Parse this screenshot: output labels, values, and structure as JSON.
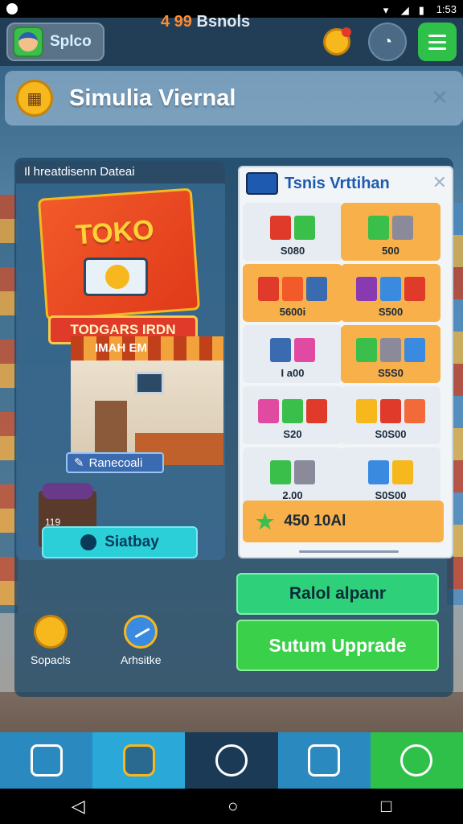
{
  "status_bar": {
    "time": "1:53"
  },
  "header": {
    "player_name": "Splco",
    "bonus_amount": "4 99",
    "bonus_label": "Bsnols"
  },
  "title": {
    "text": "Simulia Viernal"
  },
  "store_card": {
    "header": "Il hreatdisenn Dateai",
    "logo": "TOKO",
    "banner": "TODGARS IRDN",
    "sign": "IMAH EM",
    "discount_tag": "Ranecoali",
    "cart_count": "119",
    "start_button": "Siatbay",
    "mini_items": [
      {
        "label": "Sopacls",
        "icon": "coin-stack-icon"
      },
      {
        "label": "Arhsitke",
        "icon": "analytics-icon"
      }
    ]
  },
  "items_panel": {
    "title": "Tsnis Vrttihan",
    "items": [
      {
        "price": "S080",
        "style": "white",
        "colors": [
          "#e03a2a",
          "#3abf4a"
        ]
      },
      {
        "price": "500",
        "style": "orange",
        "colors": [
          "#3abf4a",
          "#8a8a9a"
        ]
      },
      {
        "price": "5600i",
        "style": "orange",
        "colors": [
          "#e03a2a",
          "#f25a2a",
          "#3a6ab0"
        ]
      },
      {
        "price": "S500",
        "style": "orange",
        "colors": [
          "#8a3ab0",
          "#3a8ae0",
          "#e03a2a"
        ]
      },
      {
        "price": "I a00",
        "style": "white",
        "colors": [
          "#3a6ab0",
          "#e04aa0"
        ]
      },
      {
        "price": "S5S0",
        "style": "orange",
        "colors": [
          "#3abf4a",
          "#8a8a9a",
          "#3a8ae0"
        ]
      },
      {
        "price": "S20",
        "style": "white",
        "colors": [
          "#e04aa0",
          "#3abf4a",
          "#e03a2a"
        ]
      },
      {
        "price": "S0S00",
        "style": "white",
        "colors": [
          "#f7b81e",
          "#e03a2a",
          "#f26a3a"
        ]
      },
      {
        "price": "2.00",
        "style": "white",
        "colors": [
          "#3abf4a",
          "#8a8a9a"
        ]
      },
      {
        "price": "S0S00",
        "style": "white",
        "colors": [
          "#3a8ae0",
          "#f7b81e"
        ]
      }
    ],
    "total": "450 10Al"
  },
  "buttons": {
    "primary": "Ralol alpanr",
    "upgrade": "Sutum Upprade"
  },
  "bottom_nav": [
    {
      "icon": "tools-icon"
    },
    {
      "icon": "coin-shop-icon"
    },
    {
      "icon": "star-gear-icon"
    },
    {
      "icon": "store-icon"
    },
    {
      "icon": "settings-gear-icon"
    }
  ]
}
